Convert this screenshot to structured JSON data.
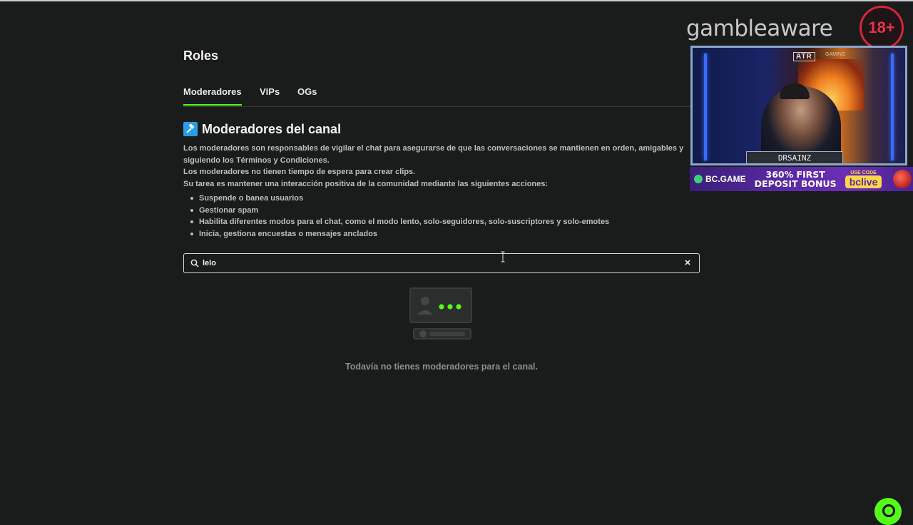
{
  "page": {
    "title": "Roles",
    "tabs": [
      {
        "label": "Moderadores",
        "active": true
      },
      {
        "label": "VIPs",
        "active": false
      },
      {
        "label": "OGs",
        "active": false
      }
    ],
    "accent_color": "#53fc18"
  },
  "section": {
    "title": "Moderadores del canal",
    "icon": "gavel-icon",
    "description": [
      "Los moderadores son responsables de vigilar el chat para asegurarse de que las conversaciones se mantienen en orden, amigables y",
      "siguiendo los Términos y Condiciones.",
      "Los moderadores no tienen tiempo de espera para crear clips.",
      "Su tarea es mantener una interacción positiva de la comunidad mediante las siguientes acciones:"
    ],
    "actions": [
      "Suspende o banea usuarios",
      "Gestionar spam",
      "Habilita diferentes modos para el chat, como el modo lento, solo-seguidores, solo-suscriptores y solo-emotes",
      "Inicia, gestiona encuestas o mensajes anclados"
    ]
  },
  "search": {
    "value": "lelo",
    "placeholder": ""
  },
  "empty_state": {
    "message": "Todavía no tienes moderadores para el canal."
  },
  "overlay": {
    "gamble_logo": "gambleaware",
    "age_badge": "18+",
    "stream_sign": "ATR",
    "stream_sign_sub": "GAMING",
    "streamer_name": "DRSAINZ",
    "ad": {
      "brand": "BC.GAME",
      "offer_line1": "360% FIRST",
      "offer_line2": "DEPOSIT BONUS",
      "code_label": "USE CODE",
      "code_value": "bclive"
    }
  }
}
